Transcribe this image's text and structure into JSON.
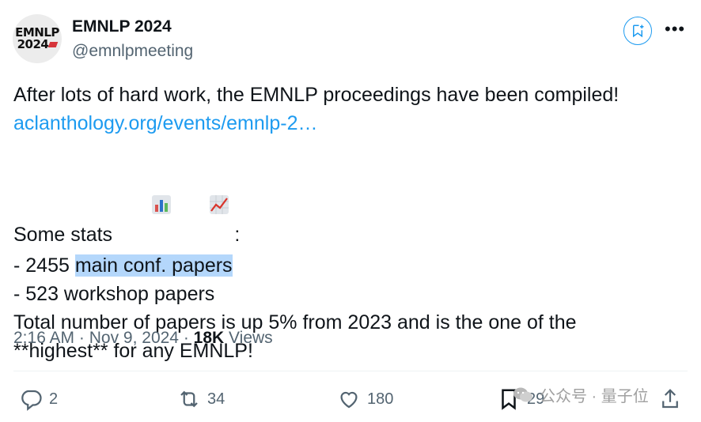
{
  "avatar": {
    "line1": "EMNLP",
    "line2": "2024"
  },
  "account": {
    "name": "EMNLP 2024",
    "handle": "@emnlpmeeting"
  },
  "tweet": {
    "line1": "After lots of hard work, the EMNLP proceedings have been compiled!",
    "link": "aclanthology.org/events/emnlp-2…",
    "stats_label": "Some stats",
    "stats_colon": ":",
    "line_main_prefix": "- 2455 ",
    "line_main_highlight": "main conf. papers",
    "line_workshop": "- 523 workshop papers",
    "line_total_1": "Total number of papers is up 5% from 2023 and is the one of the",
    "line_total_2": "**highest** for any EMNLP!"
  },
  "meta": {
    "time": "2:16 AM",
    "sep1": " · ",
    "date": "Nov 9, 2024",
    "sep2": " · ",
    "views_count": "18K",
    "views_label": " Views"
  },
  "actions": {
    "replies": "2",
    "reposts": "34",
    "likes": "180",
    "bookmarks": "29"
  },
  "watermark": {
    "text": "公众号 · 量子位"
  },
  "colors": {
    "link": "#1d9bf0",
    "highlight": "#b4d7fb",
    "muted": "#536471"
  }
}
